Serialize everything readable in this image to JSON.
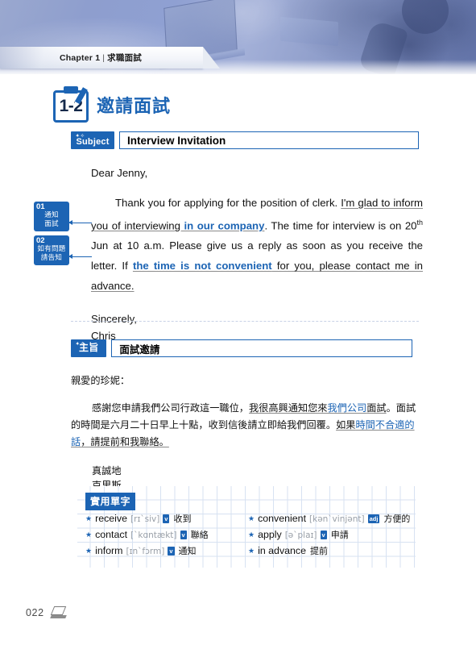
{
  "header": {
    "chapter_label": "Chapter 1",
    "separator": "|",
    "chapter_title": "求職面試"
  },
  "section": {
    "number": "1-2",
    "title": "邀請面試",
    "icon": "clipboard-pencil-icon"
  },
  "english_letter": {
    "subject_badge": "Subject",
    "subject_value": "Interview Invitation",
    "greeting": "Dear Jenny,",
    "body_segments": [
      {
        "text": "Thank you for applying for the position of clerk. ",
        "style": "plain"
      },
      {
        "text": "I'm glad to inform you of interviewing ",
        "style": "underline"
      },
      {
        "text": "in our company",
        "style": "underline-bold-blue"
      },
      {
        "text": ". The time for interview is on 20",
        "style": "plain"
      },
      {
        "text": "th",
        "style": "superscript"
      },
      {
        "text": " Jun at 10 a.m. Please give us a reply as soon as you receive the letter. If ",
        "style": "plain"
      },
      {
        "text": "the time is not convenient",
        "style": "underline-bold-blue"
      },
      {
        "text": " for you, please contact me in advance.",
        "style": "underline"
      }
    ],
    "closing": "Sincerely,",
    "signature": "Chris"
  },
  "annotations": [
    {
      "number": "01",
      "line1": "通知",
      "line2": "面試"
    },
    {
      "number": "02",
      "line1": "如有問題",
      "line2": "請告知"
    }
  ],
  "chinese_letter": {
    "subject_badge": "主旨",
    "subject_value": "面試邀請",
    "greeting": "親愛的珍妮：",
    "body_segments": [
      {
        "text": "感謝您申請我們公司行政這一職位，",
        "style": "plain"
      },
      {
        "text": "我很高興通知您來",
        "style": "underline"
      },
      {
        "text": "我們公司",
        "style": "underline-blue"
      },
      {
        "text": "面試",
        "style": "underline"
      },
      {
        "text": "。面試的時間是六月二十日早上十點，收到信後請立即給我們回覆。",
        "style": "plain"
      },
      {
        "text": "如果",
        "style": "underline"
      },
      {
        "text": "時間不合適的話",
        "style": "underline-blue"
      },
      {
        "text": "，請提前和我聯絡。",
        "style": "underline"
      }
    ],
    "closing": "真誠地",
    "signature": "克里斯"
  },
  "vocabulary": {
    "title": "實用單字",
    "left_column": [
      {
        "word": "receive",
        "phonetic": "[rɪˋsiv]",
        "pos": "v",
        "meaning": "收到"
      },
      {
        "word": "contact",
        "phonetic": "[ˋkɑntækt]",
        "pos": "v",
        "meaning": "聯絡"
      },
      {
        "word": "inform",
        "phonetic": "[ɪnˋfɔrm]",
        "pos": "v",
        "meaning": "通知"
      }
    ],
    "right_column": [
      {
        "word": "convenient",
        "phonetic": "[kənˋvinjənt]",
        "pos": "adj",
        "meaning": "方便的"
      },
      {
        "word": "apply",
        "phonetic": "[əˋplaɪ]",
        "pos": "v",
        "meaning": "申請"
      },
      {
        "word": "in advance",
        "phonetic": "",
        "pos": "",
        "meaning": "提前"
      }
    ]
  },
  "footer": {
    "page_number": "022",
    "icon": "book-icon"
  },
  "colors": {
    "accent_blue": "#1c64b4",
    "banner_blue": "#8fa0d2",
    "grid_line": "#d7e2f2"
  }
}
